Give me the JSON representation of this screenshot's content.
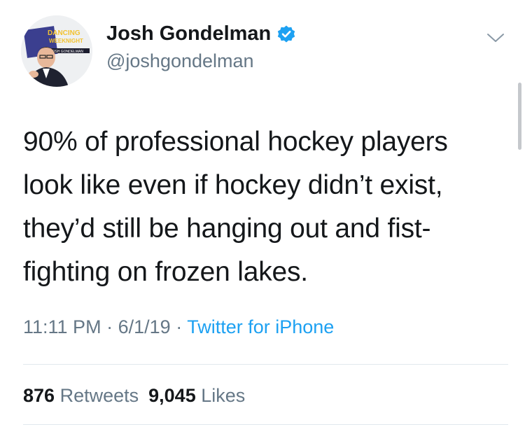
{
  "tweet": {
    "author": {
      "display_name": "Josh Gondelman",
      "handle": "@joshgondelman",
      "verified": true,
      "avatar_text": [
        "DANCING",
        "WEEKNIGHT",
        "JOSH GONDELMAN"
      ]
    },
    "text_lines": [
      "90% of professional hockey players",
      "look like even if hockey didn’t exist,",
      "they’d still be hanging out and fist-",
      "fighting on frozen lakes."
    ],
    "time": "11:11 PM",
    "date": "6/1/19",
    "separator": "·",
    "source": "Twitter for iPhone",
    "retweets_count": "876",
    "retweets_label": "Retweets",
    "likes_count": "9,045",
    "likes_label": "Likes"
  },
  "icons": {
    "verified": "verified-badge-icon",
    "menu": "chevron-down-icon"
  },
  "colors": {
    "primary_text": "#14171a",
    "secondary_text": "#657786",
    "link": "#1da1f2",
    "divider": "#e1e8ed"
  }
}
